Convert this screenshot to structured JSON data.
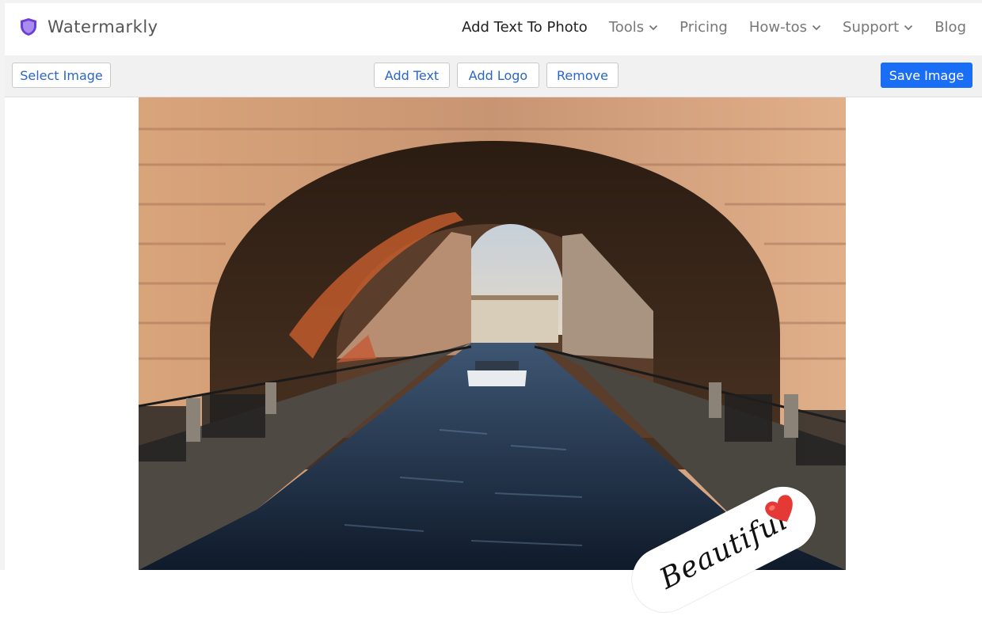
{
  "header": {
    "brand_name": "Watermarkly",
    "nav": [
      {
        "label": "Add Text To Photo",
        "active": true,
        "dropdown": false
      },
      {
        "label": "Tools",
        "dropdown": true
      },
      {
        "label": "Pricing",
        "dropdown": false
      },
      {
        "label": "How-tos",
        "dropdown": true
      },
      {
        "label": "Support",
        "dropdown": true
      },
      {
        "label": "Blog",
        "dropdown": false
      }
    ]
  },
  "toolbar": {
    "select_image": "Select Image",
    "add_text": "Add Text",
    "add_logo": "Add Logo",
    "remove": "Remove",
    "save_image": "Save Image"
  },
  "watermark": {
    "text": "Beautiful",
    "icon": "heart-icon"
  },
  "colors": {
    "accent": "#1a6ef5",
    "link": "#2a66c9",
    "brand_logo": "#6b3fd6"
  }
}
